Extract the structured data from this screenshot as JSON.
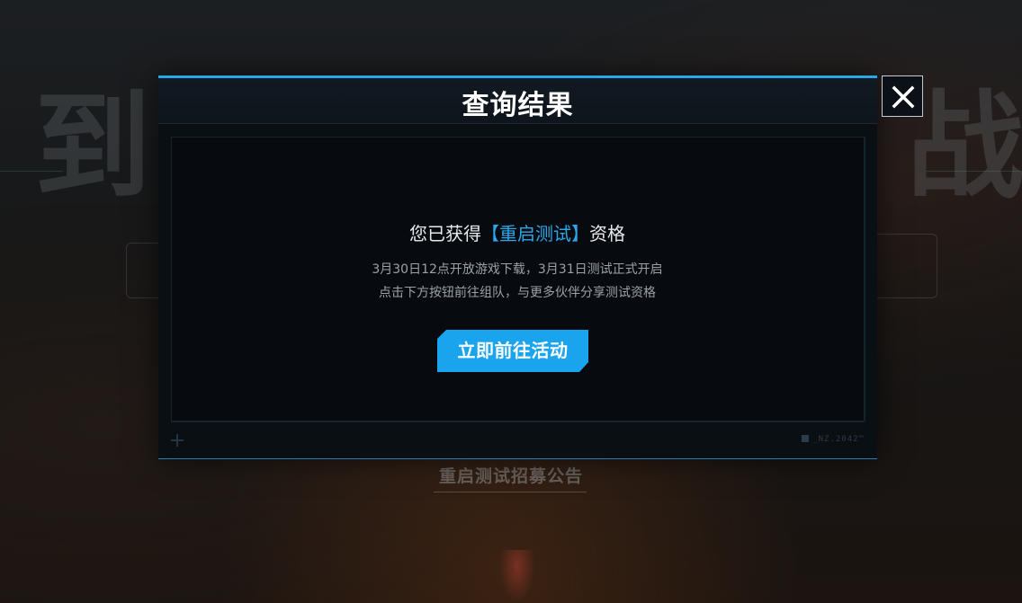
{
  "background": {
    "headline_chars_left": "到",
    "headline_chars_right": "战",
    "notice_link": "重启测试招募公告"
  },
  "modal": {
    "title": "查询结果",
    "headline_prefix": "您已获得",
    "headline_highlight": "【重启测试】",
    "headline_suffix": "资格",
    "description_line1": "3月30日12点开放游戏下载，3月31日测试正式开启",
    "description_line2": "点击下方按钮前往组队，与更多伙伴分享测试资格",
    "cta_label": "立即前往活动",
    "brand_mark": "_NZ.2042™",
    "accent_color": "#1ba4ee"
  },
  "icons": {
    "close": "close-icon",
    "corner": "plus-icon"
  }
}
